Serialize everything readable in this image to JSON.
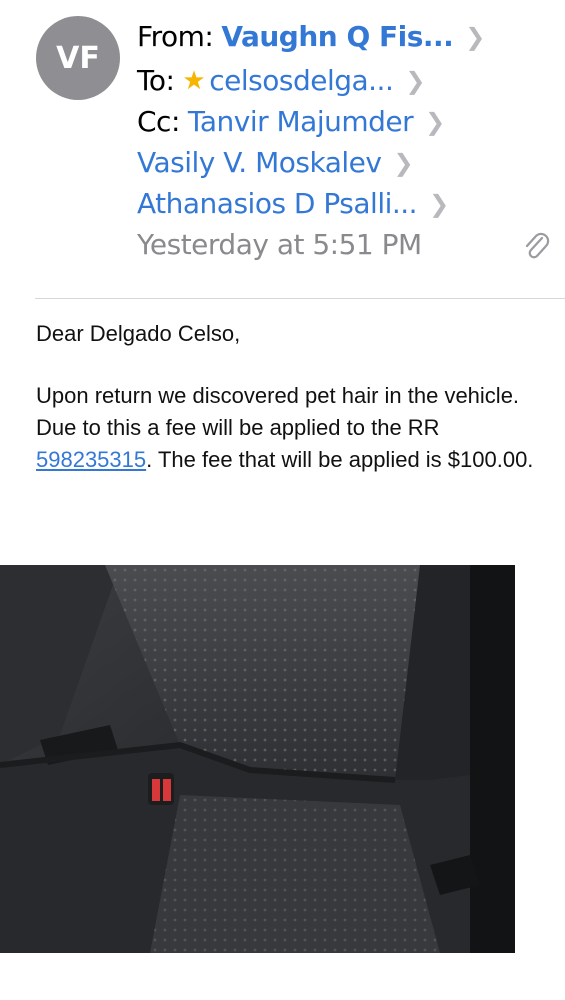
{
  "header": {
    "avatar_initials": "VF",
    "from_label": "From:",
    "from_name": "Vaughn Q Fis...",
    "to_label": "To:",
    "to_name": "celsosdelga...",
    "cc_label": "Cc:",
    "cc_names": [
      "Tanvir Majumder",
      "Vasily V. Moskalev",
      "Athanasios D Psalli..."
    ],
    "date": "Yesterday at 5:51 PM",
    "icons": {
      "chevron": "chevron-right-icon",
      "star": "star-icon",
      "attachment": "paperclip-icon"
    }
  },
  "message": {
    "greeting": "Dear Delgado Celso,",
    "p1_pre": "Upon return we discovered pet hair in the vehicle. Due to this a fee will be applied to the RR ",
    "rr_link": "598235315",
    "p1_post": ". The fee that will be applied is $100.00."
  },
  "colors": {
    "link": "#3478d6",
    "star": "#f7b500",
    "avatar": "#8e8e93"
  }
}
